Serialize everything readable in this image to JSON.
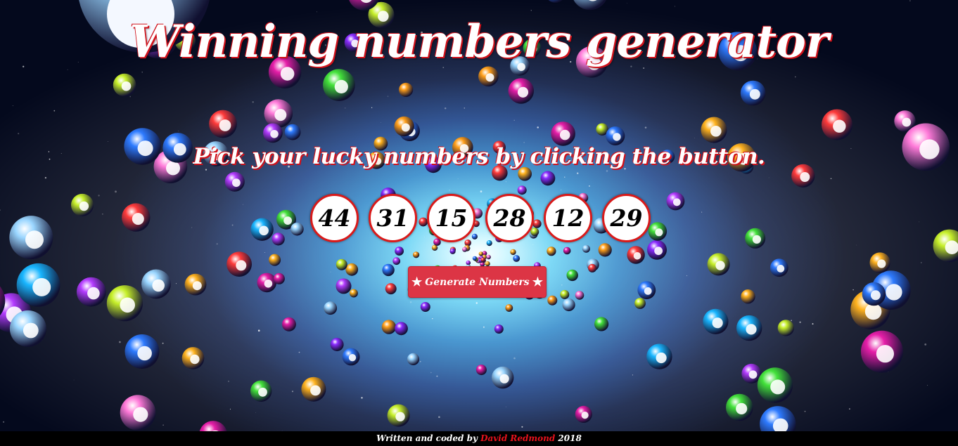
{
  "header": {
    "title": "Winning numbers generator",
    "subtitle": "Pick your lucky numbers by clicking the button."
  },
  "numbers": [
    "44",
    "31",
    "15",
    "28",
    "12",
    "29"
  ],
  "generate_button": {
    "label": "Generate Numbers",
    "icon": "star-icon"
  },
  "footer": {
    "prefix": "Written and coded by",
    "author": "David Redmond",
    "year": "2018"
  },
  "colors": {
    "accent_red": "#d0121b",
    "button_red": "#dc3545",
    "ball_border": "#d91a1a",
    "footer_bg": "#000000"
  },
  "background_balls": [
    {
      "c": "#9ad6ff"
    },
    {
      "c": "#e61ea8"
    },
    {
      "c": "#ffb21e"
    },
    {
      "c": "#8b2cff"
    },
    {
      "c": "#43e23a"
    },
    {
      "c": "#19b6ff"
    },
    {
      "c": "#ff3b3b"
    },
    {
      "c": "#c7f02a"
    },
    {
      "c": "#ff7ad9"
    },
    {
      "c": "#2e7bff"
    },
    {
      "c": "#ff9f1a"
    },
    {
      "c": "#b43cff"
    }
  ]
}
